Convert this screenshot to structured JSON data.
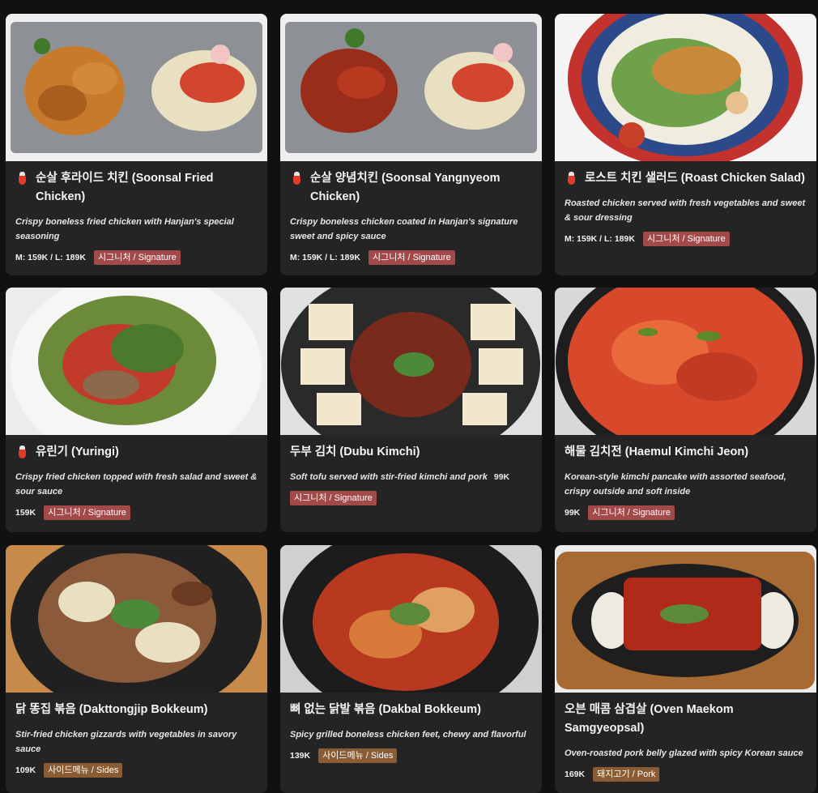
{
  "colors": {
    "page_bg": "#111111",
    "card_bg": "#242424",
    "signature_badge": "#a24a4a",
    "sides_badge": "#8a5c34",
    "pork_badge": "#8a5c34",
    "spicy_icon": "#e23b2a"
  },
  "items": [
    {
      "title": "순살 후라이드 치킨 (Soonsal Fried Chicken)",
      "spicy_icon": "chili-pepper-icon",
      "description": "Crispy boneless fried chicken with Hanjan's special seasoning",
      "price": "M: 159K / L: 189K",
      "badge": "시그니처 / Signature"
    },
    {
      "title": "순살 양념치킨 (Soonsal Yangnyeom Chicken)",
      "spicy_icon": "chili-pepper-icon",
      "description": " Crispy boneless chicken coated in Hanjan's signature sweet and spicy sauce",
      "price": "M: 159K / L: 189K",
      "badge": "시그니처 / Signature"
    },
    {
      "title": "로스트 치킨 샐러드 (Roast Chicken Salad)",
      "spicy_icon": "chili-pepper-icon",
      "description": "Roasted chicken served with fresh vegetables and sweet & sour dressing",
      "price": "M: 159K / L: 189K",
      "badge": "시그니처 / Signature"
    },
    {
      "title": "유린기 (Yuringi)",
      "spicy_icon": "chili-pepper-icon",
      "description": "Crispy fried chicken topped with fresh salad and sweet & sour sauce",
      "price": "159K",
      "badge": "시그니처 / Signature"
    },
    {
      "title": "두부 김치 (Dubu Kimchi)",
      "description": "Soft tofu served with stir-fried kimchi and pork",
      "price": "99K",
      "badge": "시그니처 / Signature"
    },
    {
      "title": "해물 김치전 (Haemul Kimchi Jeon)",
      "description": "Korean-style kimchi pancake with assorted seafood, crispy outside and soft inside",
      "price": "99K",
      "badge": "시그니처 / Signature"
    },
    {
      "title": "닭 똥집 볶음 (Dakttongjip Bokkeum)",
      "description": "Stir-fried chicken gizzards with vegetables in savory sauce",
      "price": "109K",
      "badge": "사이드메뉴 / Sides"
    },
    {
      "title": "뼈 없는 닭발 볶음 (Dakbal Bokkeum)",
      "description": "Spicy grilled boneless chicken feet, chewy and flavorful",
      "price": "139K",
      "badge": "사이드메뉴 / Sides"
    },
    {
      "title": "오븐 매콤 삼겹살 (Oven Maekom Samgyeopsal)",
      "description": "Oven-roasted pork belly glazed with spicy Korean sauce",
      "price": "169K",
      "badge": "돼지고기 / Pork"
    }
  ]
}
